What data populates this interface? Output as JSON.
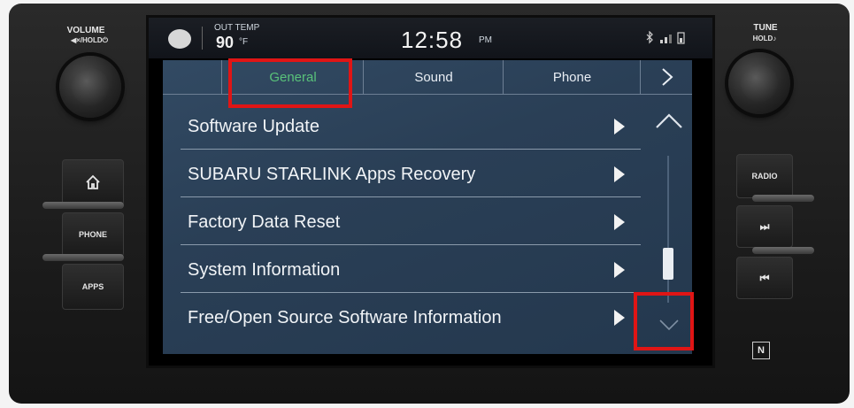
{
  "left_panel": {
    "volume_label": "VOLUME",
    "volume_sub": "◀×/HOLD⏻",
    "buttons": [
      {
        "label": ""
      },
      {
        "label": "PHONE"
      },
      {
        "label": "APPS"
      }
    ]
  },
  "right_panel": {
    "tune_label": "TUNE",
    "tune_sub": "HOLD♪",
    "buttons": [
      {
        "label": "RADIO"
      },
      {
        "label": "⏭"
      },
      {
        "label": "⏮"
      }
    ],
    "nfc_label": "N"
  },
  "status_bar": {
    "outside_temp_label": "OUT TEMP",
    "outside_temp_value": "90",
    "temp_unit": "°F",
    "time": "12:58",
    "meridiem": "PM"
  },
  "tabs": [
    {
      "label": "General",
      "active": true
    },
    {
      "label": "Sound",
      "active": false
    },
    {
      "label": "Phone",
      "active": false
    }
  ],
  "settings_items": [
    {
      "label": "Software Update"
    },
    {
      "label": "SUBARU STARLINK Apps Recovery"
    },
    {
      "label": "Factory Data Reset"
    },
    {
      "label": "System Information"
    },
    {
      "label": "Free/Open Source Software Information"
    }
  ],
  "scrollbar": {
    "position_fraction": 0.8
  },
  "colors": {
    "accent": "#59c27a",
    "highlight": "#e01515",
    "screen_bg": "#2a3f56"
  }
}
